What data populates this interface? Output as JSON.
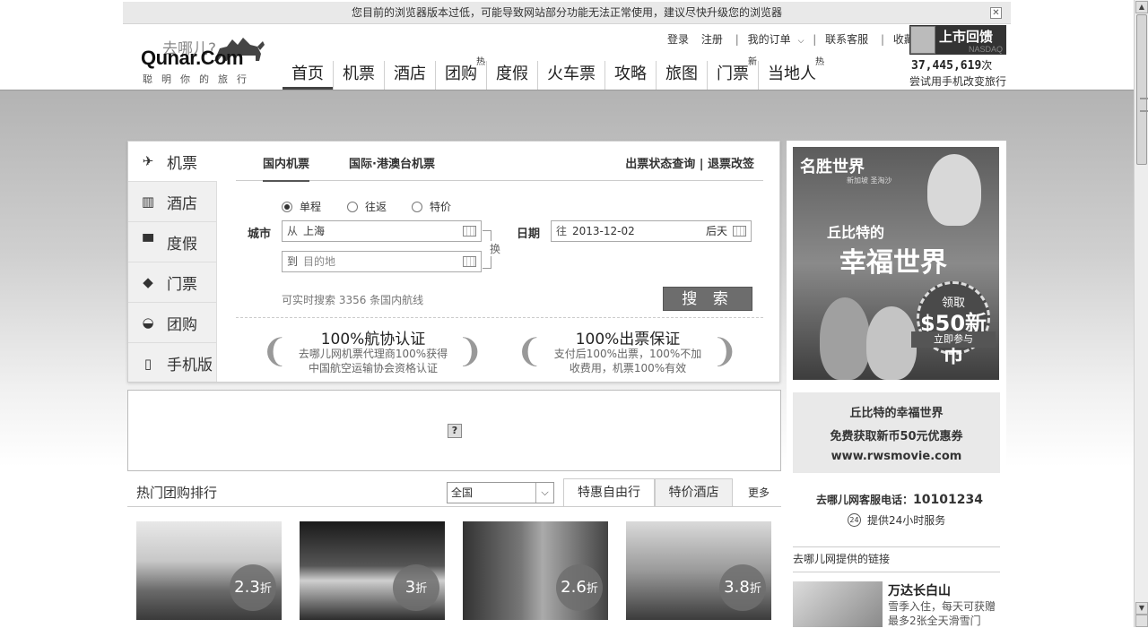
{
  "browser_warning": "您目前的浏览器版本过低，可能导致网站部分功能无法正常使用，建议尽快升级您的浏览器",
  "logo": {
    "slogan": "去哪儿?",
    "brand": "Qunar.Com",
    "tagline": "聪明你的旅行"
  },
  "top_links": {
    "login": "登录",
    "register": "注册",
    "my_orders": "我的订单",
    "service": "联系客服",
    "favorites": "收藏"
  },
  "ipo": {
    "title": "上市回馈",
    "exchange": "NASDAQ"
  },
  "counter": {
    "value": "37,445,619",
    "unit": "次",
    "caption": "尝试用手机改变旅行"
  },
  "nav": [
    {
      "label": "首页",
      "badge": ""
    },
    {
      "label": "机票",
      "badge": ""
    },
    {
      "label": "酒店",
      "badge": ""
    },
    {
      "label": "团购",
      "badge": "热"
    },
    {
      "label": "度假",
      "badge": ""
    },
    {
      "label": "火车票",
      "badge": ""
    },
    {
      "label": "攻略",
      "badge": ""
    },
    {
      "label": "旅图",
      "badge": ""
    },
    {
      "label": "门票",
      "badge": "新"
    },
    {
      "label": "当地人",
      "badge": "热"
    }
  ],
  "side_tabs": [
    {
      "label": "机票",
      "icon": "airplane-icon"
    },
    {
      "label": "酒店",
      "icon": "building-icon"
    },
    {
      "label": "度假",
      "icon": "suitcase-icon"
    },
    {
      "label": "门票",
      "icon": "tag-icon"
    },
    {
      "label": "团购",
      "icon": "basket-icon"
    },
    {
      "label": "手机版",
      "icon": "mobile-icon"
    }
  ],
  "flight": {
    "tab_domestic": "国内机票",
    "tab_intl": "国际·港澳台机票",
    "query_links": "出票状态查询 | 退票改签",
    "trip_types": [
      "单程",
      "往返",
      "特价"
    ],
    "city_label": "城市",
    "from_prefix": "从",
    "from_value": "上海",
    "to_prefix": "到",
    "to_placeholder": "目的地",
    "swap": "换",
    "date_label": "日期",
    "date_prefix": "往",
    "date_value": "2013-12-02",
    "date_suffix": "后天",
    "route_count": "可实时搜索 3356 条国内航线",
    "search": "搜 索"
  },
  "certs": [
    {
      "title": "100%航协认证",
      "desc": "去哪儿网机票代理商100%获得中国航空运输协会资格认证"
    },
    {
      "title": "100%出票保证",
      "desc": "支付后100%出票，100%不加收费用，机票100%有效"
    }
  ],
  "ad": {
    "placeholder": "?"
  },
  "group": {
    "title": "热门团购排行",
    "region": "全国",
    "tabs": [
      "特惠自由行",
      "特价酒店"
    ],
    "more": "更多",
    "deals": [
      {
        "disc": "2.3",
        "unit": "折"
      },
      {
        "disc": "3",
        "unit": "折"
      },
      {
        "disc": "2.6",
        "unit": "折"
      },
      {
        "disc": "3.8",
        "unit": "折"
      }
    ]
  },
  "banner": {
    "logo": "名胜世界",
    "logo_sub": "新加坡 圣淘沙",
    "head1": "丘比特的",
    "head2": "幸福世界",
    "badge_l1": "领取",
    "badge_l2": "$50新币",
    "cta": "立即参与"
  },
  "promo": {
    "line1": "丘比特的幸福世界",
    "line2": "免费获取新币50元优惠券",
    "line3": "www.rwsmovie.com"
  },
  "hotline": {
    "label": "去哪儿网客服电话：",
    "number": "10101234",
    "service": "提供24小时服务",
    "icon_text": "24"
  },
  "links": {
    "title": "去哪儿网提供的链接",
    "item_title": "万达长白山",
    "item_desc": "雪季入住，每天可获赠最多2张全天滑雪门"
  }
}
